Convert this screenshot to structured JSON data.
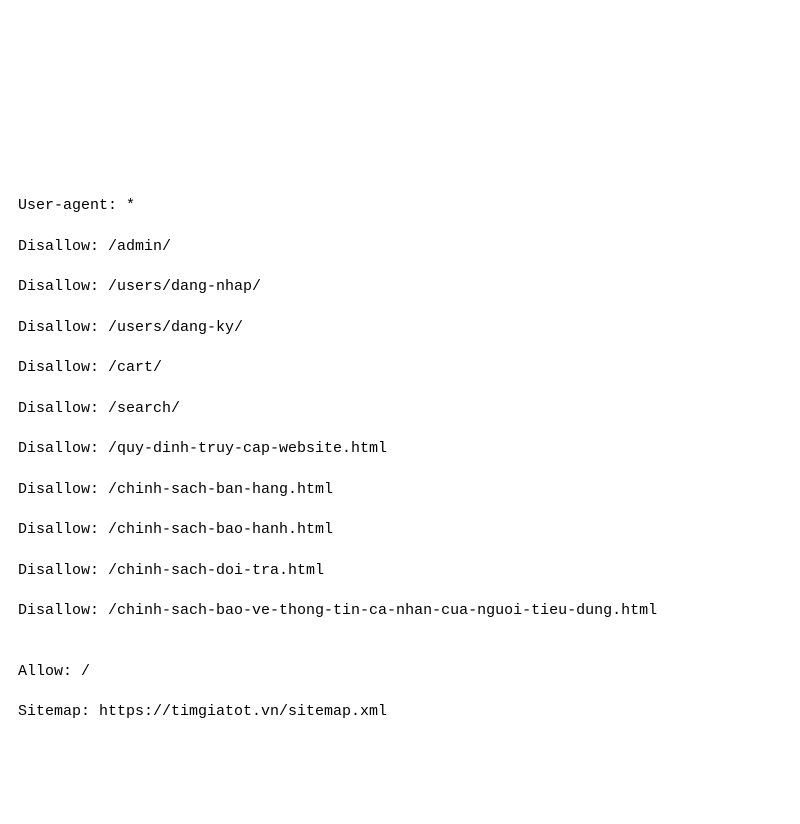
{
  "robots": {
    "user_agent_line": "User-agent: *",
    "disallow_lines": [
      "Disallow: /admin/",
      "Disallow: /users/dang-nhap/",
      "Disallow: /users/dang-ky/",
      "Disallow: /cart/",
      "Disallow: /search/",
      "Disallow: /quy-dinh-truy-cap-website.html",
      "Disallow: /chinh-sach-ban-hang.html",
      "Disallow: /chinh-sach-bao-hanh.html",
      "Disallow: /chinh-sach-doi-tra.html",
      "Disallow: /chinh-sach-bao-ve-thong-tin-ca-nhan-cua-nguoi-tieu-dung.html"
    ],
    "allow_line": "Allow: /",
    "sitemap_line": "Sitemap: https://timgiatot.vn/sitemap.xml"
  }
}
